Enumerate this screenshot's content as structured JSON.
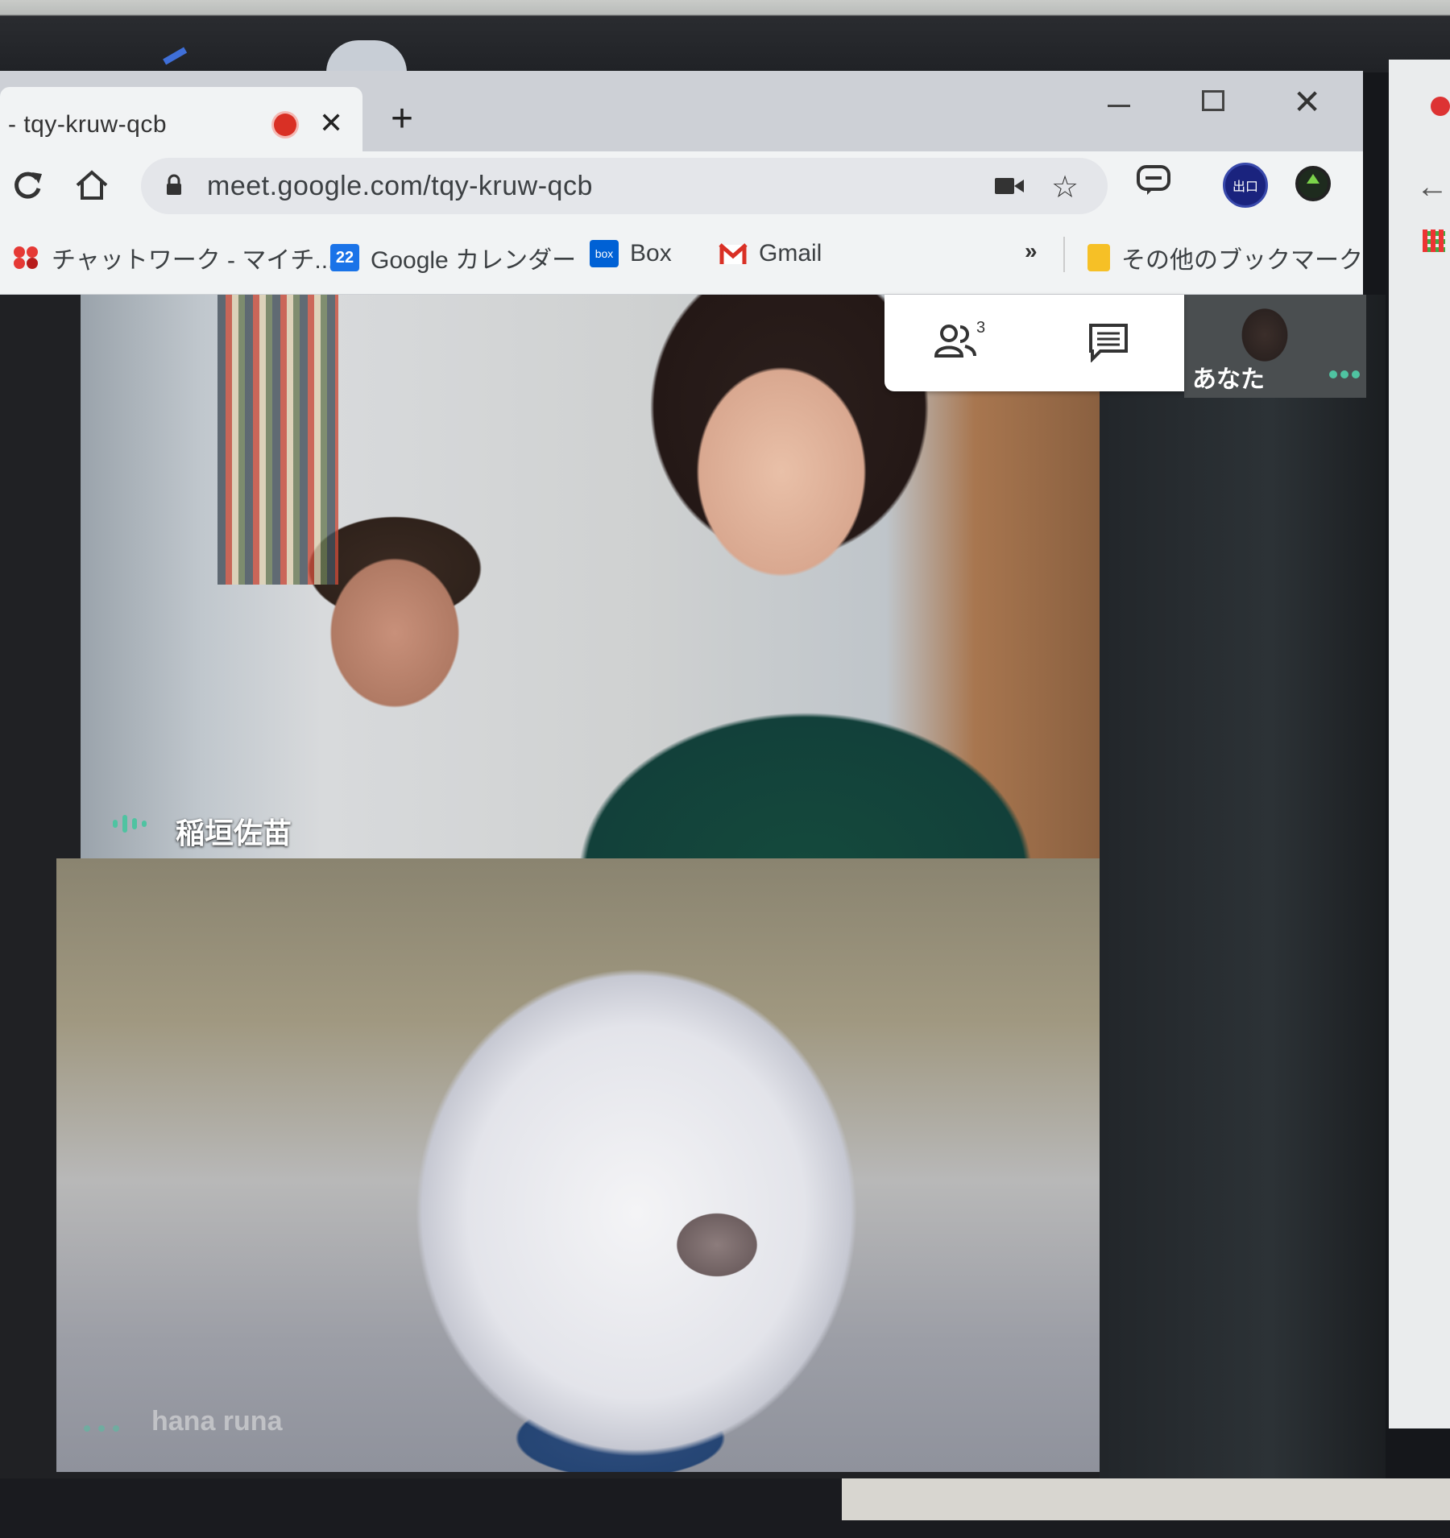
{
  "tab": {
    "title": "- tqy-kruw-qcb",
    "close_glyph": "✕",
    "new_tab_glyph": "+"
  },
  "window_controls": {
    "close_glyph": "✕"
  },
  "toolbar": {
    "url": "meet.google.com/tqy-kruw-qcb",
    "star_glyph": "☆",
    "profile_label": "出口"
  },
  "bookmarks": {
    "items": [
      {
        "label": "チャットワーク - マイチ...",
        "icon": "chatwork-icon"
      },
      {
        "label": "Google カレンダー",
        "icon": "calendar-icon",
        "badge": "22"
      },
      {
        "label": "Box",
        "icon": "box-icon",
        "badge": "box"
      },
      {
        "label": "Gmail",
        "icon": "gmail-icon"
      }
    ],
    "more_glyph": "»",
    "other_label": "その他のブックマーク"
  },
  "meet": {
    "participant_count": "3",
    "tiles": [
      {
        "name": "稲垣佐苗"
      },
      {
        "name": "hana runa"
      }
    ],
    "self_label": "あなた"
  },
  "colors": {
    "record": "#d93025",
    "audio_active": "#4fc3a1",
    "profile": "#1a237e"
  }
}
